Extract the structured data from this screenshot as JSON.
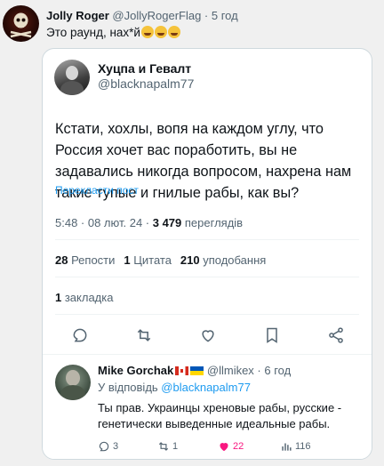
{
  "outer_post": {
    "display_name": "Jolly Roger",
    "handle_time": "@JollyRogerFlag · 5 год",
    "text": "Это раунд, нах*й"
  },
  "quoted_post": {
    "display_name": "Хуцпа и Гевалт",
    "handle": "@blacknapalm77",
    "text": "Кстати, хохлы, вопя на каждом углу, что Россия хочет вас поработить, вы не задавались никогда вопросом, нахрена нам такие тупые и гнилые рабы, как вы?",
    "translate_label": "Перекласти пост",
    "time_date": "5:48 · 08 лют. 24 · ",
    "views_count": "3 479",
    "views_label": " переглядів",
    "reposts_count": "28",
    "reposts_label": " Репости",
    "quotes_count": "1",
    "quotes_label": " Цитата",
    "likes_count": "210",
    "likes_label": " уподобання",
    "bookmarks_count": "1",
    "bookmarks_label": " закладка"
  },
  "reply": {
    "display_name": "Mike Gorchak",
    "handle_time": "@llmikex · 6 год",
    "reply_to_prefix": "У відповідь ",
    "reply_to_handle": "@blacknapalm77",
    "text": "Ты прав. Украинцы хреновые рабы, русские - генетически выведенные идеальные рабы.",
    "replies": "3",
    "reposts": "1",
    "likes": "22",
    "views": "116"
  },
  "icons": {
    "reply": "reply-icon",
    "repost": "repost-icon",
    "like": "heart-icon",
    "bookmark": "bookmark-icon",
    "share": "share-icon",
    "views": "views-icon"
  },
  "colors": {
    "accent": "#1d9bf0",
    "secondary_text": "#536471",
    "like_active": "#f91880"
  }
}
